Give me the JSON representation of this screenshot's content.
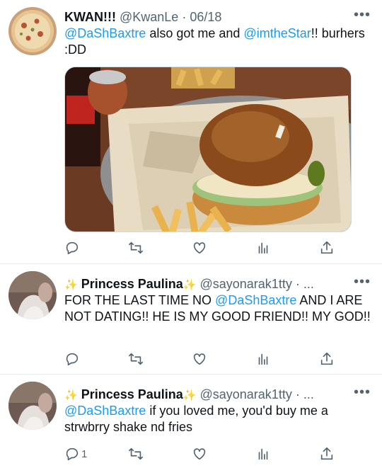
{
  "tweets": [
    {
      "display_name": "KWAN!!!",
      "handle": "@KwanLe",
      "date_sep": " · ",
      "date": "06/18",
      "text_parts": [
        "@DaShBaxtre",
        " also got me and ",
        "@imtheStar",
        "!! burhers :DD"
      ],
      "reply_count": ""
    },
    {
      "display_name": "Princess Paulina",
      "sparkle": "✨",
      "handle": "@sayonarak1tty · ...",
      "text_parts": [
        "FOR THE LAST TIME NO ",
        "@DaShBaxtre",
        " AND I ARE NOT DATING!! HE IS MY GOOD FRIEND!! MY GOD!!"
      ],
      "reply_count": ""
    },
    {
      "display_name": "Princess Paulina",
      "sparkle": "✨",
      "handle": "@sayonarak1tty · ...",
      "text_parts": [
        "@DaShBaxtre",
        " if you loved me, you'd buy me a strwbrry shake nd fries"
      ],
      "reply_count": "1"
    }
  ],
  "more_glyph": "•••",
  "icons": [
    "reply-icon",
    "retweet-icon",
    "like-icon",
    "analytics-icon",
    "share-icon"
  ],
  "colors": {
    "link": "#1d9bf0",
    "secondary": "#536471",
    "border": "#e6ecf0"
  }
}
